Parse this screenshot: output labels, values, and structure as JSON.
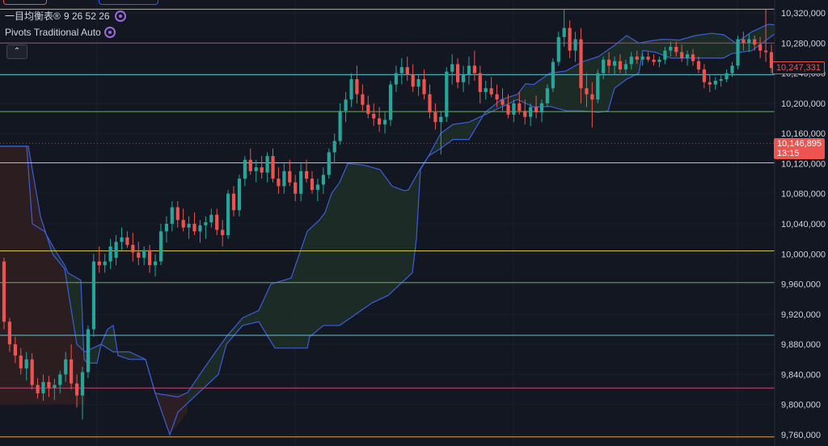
{
  "legend": {
    "ichimoku": {
      "name": "一目均衡表®",
      "params": "9 26 52 26"
    },
    "pivots": {
      "name": "Pivots Traditional Auto"
    },
    "collapse_glyph": "⌃"
  },
  "price_axis": {
    "ticks": [
      "10,320,000",
      "10,280,000",
      "10,240,000",
      "10,200,000",
      "10,160,000",
      "10,120,000",
      "10,080,000",
      "10,040,000",
      "10,000,000",
      "9,960,000",
      "9,920,000",
      "9,880,000",
      "9,840,000",
      "9,800,000",
      "9,760,000"
    ],
    "current_price_label": "10,247,331",
    "last_price_label": "10,146,895",
    "countdown": "13:15"
  },
  "colors": {
    "background": "#131722",
    "up": "#26a69a",
    "down": "#ef5350",
    "cloud_line": "#3b5ed8",
    "cloud_fill_bull": "#1f2d27",
    "cloud_fill_bear": "#2d1d22"
  },
  "chart_data": {
    "type": "candlestick",
    "y_range": [
      9756000,
      10330000
    ],
    "pivot_levels": [
      {
        "value": 10325000,
        "color": "#e0a44a"
      },
      {
        "value": 10280000,
        "color": "#b04a6a"
      },
      {
        "value": 10238000,
        "color": "#5ec6d6"
      },
      {
        "value": 10189000,
        "color": "#6fae5c"
      },
      {
        "value": 10121000,
        "color": "#d4c24a"
      },
      {
        "value": 10004000,
        "color": "#d4c24a"
      },
      {
        "value": 9962000,
        "color": "#6fae5c"
      },
      {
        "value": 9892000,
        "color": "#5ec6d6"
      },
      {
        "value": 9822000,
        "color": "#c24a78"
      },
      {
        "value": 9757000,
        "color": "#e0a44a"
      }
    ],
    "candles": [
      [
        9990000,
        9995000,
        9900000,
        9910000
      ],
      [
        9910000,
        9915000,
        9870000,
        9880000
      ],
      [
        9880000,
        9890000,
        9855000,
        9865000
      ],
      [
        9865000,
        9875000,
        9840000,
        9848000
      ],
      [
        9848000,
        9870000,
        9832000,
        9860000
      ],
      [
        9860000,
        9868000,
        9820000,
        9826000
      ],
      [
        9826000,
        9835000,
        9808000,
        9815000
      ],
      [
        9815000,
        9840000,
        9805000,
        9830000
      ],
      [
        9830000,
        9838000,
        9810000,
        9822000
      ],
      [
        9822000,
        9834000,
        9806000,
        9826000
      ],
      [
        9826000,
        9845000,
        9815000,
        9840000
      ],
      [
        9840000,
        9870000,
        9830000,
        9860000
      ],
      [
        9860000,
        9880000,
        9820000,
        9828000
      ],
      [
        9828000,
        9840000,
        9796000,
        9812000
      ],
      [
        9812000,
        9850000,
        9780000,
        9843000
      ],
      [
        9843000,
        9905000,
        9835000,
        9900000
      ],
      [
        9900000,
        10000000,
        9890000,
        9990000
      ],
      [
        9990000,
        10010000,
        9975000,
        9985000
      ],
      [
        9985000,
        10000000,
        9975000,
        9990000
      ],
      [
        9990000,
        10020000,
        9980000,
        10010000
      ],
      [
        9995000,
        10025000,
        9985000,
        10016000
      ],
      [
        10016000,
        10035000,
        10005000,
        10022000
      ],
      [
        10022000,
        10030000,
        10008000,
        10012000
      ],
      [
        10012000,
        10028000,
        9990000,
        10002000
      ],
      [
        10002000,
        10016000,
        9985000,
        9995000
      ],
      [
        9995000,
        10010000,
        9985000,
        10005000
      ],
      [
        10005000,
        10012000,
        9975000,
        9985000
      ],
      [
        9985000,
        10000000,
        9970000,
        9990000
      ],
      [
        9990000,
        10040000,
        9985000,
        10030000
      ],
      [
        10030000,
        10050000,
        10015000,
        10040000
      ],
      [
        10040000,
        10070000,
        10030000,
        10062000
      ],
      [
        10062000,
        10070000,
        10035000,
        10045000
      ],
      [
        10045000,
        10060000,
        10030000,
        10035000
      ],
      [
        10035000,
        10050000,
        10020000,
        10040000
      ],
      [
        10040000,
        10055000,
        10025000,
        10030000
      ],
      [
        10030000,
        10045000,
        10015000,
        10038000
      ],
      [
        10038000,
        10050000,
        10020000,
        10042000
      ],
      [
        10042000,
        10060000,
        10035000,
        10052000
      ],
      [
        10052000,
        10060000,
        10025000,
        10032000
      ],
      [
        10032000,
        10045000,
        10010000,
        10025000
      ],
      [
        10025000,
        10085000,
        10020000,
        10080000
      ],
      [
        10080000,
        10090000,
        10050000,
        10058000
      ],
      [
        10058000,
        10105000,
        10050000,
        10100000
      ],
      [
        10100000,
        10130000,
        10090000,
        10125000
      ],
      [
        10125000,
        10140000,
        10105000,
        10110000
      ],
      [
        10110000,
        10125000,
        10095000,
        10115000
      ],
      [
        10115000,
        10130000,
        10100000,
        10108000
      ],
      [
        10108000,
        10135000,
        10095000,
        10130000
      ],
      [
        10130000,
        10140000,
        10095000,
        10100000
      ],
      [
        10100000,
        10115000,
        10080000,
        10090000
      ],
      [
        10090000,
        10120000,
        10080000,
        10110000
      ],
      [
        10110000,
        10125000,
        10090000,
        10095000
      ],
      [
        10095000,
        10105000,
        10070000,
        10080000
      ],
      [
        10080000,
        10120000,
        10070000,
        10110000
      ],
      [
        10110000,
        10125000,
        10095000,
        10100000
      ],
      [
        10100000,
        10110000,
        10080000,
        10085000
      ],
      [
        10085000,
        10100000,
        10070000,
        10092000
      ],
      [
        10092000,
        10115000,
        10080000,
        10105000
      ],
      [
        10105000,
        10140000,
        10100000,
        10135000
      ],
      [
        10135000,
        10160000,
        10120000,
        10150000
      ],
      [
        10150000,
        10200000,
        10145000,
        10190000
      ],
      [
        10190000,
        10215000,
        10175000,
        10205000
      ],
      [
        10205000,
        10240000,
        10195000,
        10232000
      ],
      [
        10232000,
        10250000,
        10200000,
        10212000
      ],
      [
        10212000,
        10225000,
        10190000,
        10198000
      ],
      [
        10198000,
        10210000,
        10180000,
        10186000
      ],
      [
        10186000,
        10200000,
        10170000,
        10180000
      ],
      [
        10180000,
        10195000,
        10162000,
        10172000
      ],
      [
        10172000,
        10188000,
        10160000,
        10178000
      ],
      [
        10178000,
        10230000,
        10170000,
        10225000
      ],
      [
        10225000,
        10250000,
        10215000,
        10240000
      ],
      [
        10240000,
        10260000,
        10225000,
        10248000
      ],
      [
        10248000,
        10262000,
        10230000,
        10238000
      ],
      [
        10238000,
        10252000,
        10215000,
        10222000
      ],
      [
        10222000,
        10238000,
        10210000,
        10232000
      ],
      [
        10232000,
        10245000,
        10205000,
        10212000
      ],
      [
        10212000,
        10225000,
        10180000,
        10188000
      ],
      [
        10188000,
        10200000,
        10165000,
        10175000
      ],
      [
        10175000,
        10190000,
        10132000,
        10182000
      ],
      [
        10182000,
        10248000,
        10175000,
        10242000
      ],
      [
        10242000,
        10265000,
        10225000,
        10252000
      ],
      [
        10252000,
        10260000,
        10220000,
        10228000
      ],
      [
        10228000,
        10250000,
        10215000,
        10238000
      ],
      [
        10238000,
        10262000,
        10225000,
        10250000
      ],
      [
        10250000,
        10270000,
        10230000,
        10240000
      ],
      [
        10240000,
        10250000,
        10200000,
        10215000
      ],
      [
        10215000,
        10230000,
        10205000,
        10220000
      ],
      [
        10220000,
        10235000,
        10208000,
        10212000
      ],
      [
        10212000,
        10225000,
        10195000,
        10205000
      ],
      [
        10205000,
        10220000,
        10190000,
        10198000
      ],
      [
        10198000,
        10212000,
        10180000,
        10185000
      ],
      [
        10185000,
        10205000,
        10175000,
        10200000
      ],
      [
        10200000,
        10215000,
        10185000,
        10190000
      ],
      [
        10190000,
        10205000,
        10172000,
        10182000
      ],
      [
        10182000,
        10200000,
        10170000,
        10195000
      ],
      [
        10195000,
        10210000,
        10180000,
        10188000
      ],
      [
        10188000,
        10205000,
        10175000,
        10200000
      ],
      [
        10200000,
        10225000,
        10195000,
        10220000
      ],
      [
        10220000,
        10260000,
        10215000,
        10255000
      ],
      [
        10255000,
        10295000,
        10250000,
        10288000
      ],
      [
        10288000,
        10325000,
        10275000,
        10300000
      ],
      [
        10300000,
        10310000,
        10260000,
        10270000
      ],
      [
        10270000,
        10295000,
        10255000,
        10285000
      ],
      [
        10285000,
        10300000,
        10200000,
        10220000
      ],
      [
        10220000,
        10240000,
        10195000,
        10212000
      ],
      [
        10212000,
        10228000,
        10168000,
        10205000
      ],
      [
        10205000,
        10245000,
        10200000,
        10240000
      ],
      [
        10240000,
        10262000,
        10232000,
        10258000
      ],
      [
        10258000,
        10268000,
        10240000,
        10250000
      ],
      [
        10250000,
        10262000,
        10238000,
        10256000
      ],
      [
        10256000,
        10265000,
        10240000,
        10245000
      ],
      [
        10245000,
        10258000,
        10238000,
        10252000
      ],
      [
        10252000,
        10268000,
        10245000,
        10262000
      ],
      [
        10262000,
        10270000,
        10252000,
        10258000
      ],
      [
        10258000,
        10266000,
        10250000,
        10262000
      ],
      [
        10262000,
        10268000,
        10255000,
        10258000
      ],
      [
        10258000,
        10265000,
        10250000,
        10255000
      ],
      [
        10255000,
        10262000,
        10248000,
        10258000
      ],
      [
        10258000,
        10275000,
        10252000,
        10270000
      ],
      [
        10270000,
        10282000,
        10262000,
        10275000
      ],
      [
        10275000,
        10282000,
        10262000,
        10268000
      ],
      [
        10268000,
        10278000,
        10255000,
        10260000
      ],
      [
        10260000,
        10270000,
        10250000,
        10265000
      ],
      [
        10265000,
        10272000,
        10250000,
        10256000
      ],
      [
        10256000,
        10262000,
        10240000,
        10245000
      ],
      [
        10245000,
        10252000,
        10220000,
        10228000
      ],
      [
        10228000,
        10238000,
        10215000,
        10225000
      ],
      [
        10225000,
        10235000,
        10218000,
        10230000
      ],
      [
        10230000,
        10238000,
        10222000,
        10232000
      ],
      [
        10232000,
        10245000,
        10228000,
        10240000
      ],
      [
        10240000,
        10255000,
        10235000,
        10250000
      ],
      [
        10250000,
        10290000,
        10245000,
        10285000
      ],
      [
        10285000,
        10295000,
        10270000,
        10280000
      ],
      [
        10280000,
        10292000,
        10268000,
        10285000
      ],
      [
        10285000,
        10290000,
        10270000,
        10278000
      ],
      [
        10278000,
        10288000,
        10260000,
        10270000
      ],
      [
        10270000,
        10325000,
        10255000,
        10268000
      ],
      [
        10268000,
        10278000,
        10240000,
        10247000
      ]
    ],
    "cloud_top": [
      [
        0,
        10143000
      ],
      [
        33,
        10143000
      ],
      [
        40,
        10040000
      ],
      [
        55,
        10030000
      ],
      [
        68,
        10005000
      ],
      [
        80,
        9985000
      ],
      [
        84,
        9975000
      ],
      [
        100,
        9965000
      ],
      [
        104,
        9860000
      ],
      [
        108,
        9855000
      ],
      [
        120,
        9855000
      ],
      [
        125,
        9880000
      ],
      [
        133,
        9900000
      ],
      [
        140,
        9905000
      ],
      [
        146,
        9865000
      ],
      [
        160,
        9860000
      ],
      [
        180,
        9860000
      ],
      [
        192,
        9815000
      ],
      [
        220,
        9810000
      ],
      [
        232,
        9816000
      ],
      [
        260,
        9860000
      ],
      [
        280,
        9890000
      ],
      [
        300,
        9915000
      ],
      [
        320,
        9925000
      ],
      [
        335,
        9960000
      ],
      [
        360,
        9968000
      ],
      [
        380,
        10030000
      ],
      [
        395,
        10045000
      ],
      [
        402,
        10055000
      ],
      [
        410,
        10080000
      ],
      [
        420,
        10095000
      ],
      [
        430,
        10120000
      ],
      [
        450,
        10118000
      ],
      [
        470,
        10112000
      ],
      [
        485,
        10090000
      ],
      [
        500,
        10084000
      ],
      [
        505,
        10085000
      ],
      [
        518,
        10110000
      ],
      [
        530,
        10130000
      ],
      [
        545,
        10140000
      ],
      [
        560,
        10152000
      ],
      [
        580,
        10152000
      ],
      [
        600,
        10188000
      ],
      [
        620,
        10205000
      ],
      [
        640,
        10212000
      ],
      [
        650,
        10226000
      ],
      [
        660,
        10225000
      ],
      [
        680,
        10240000
      ],
      [
        700,
        10243000
      ],
      [
        720,
        10255000
      ],
      [
        740,
        10262000
      ],
      [
        760,
        10277000
      ],
      [
        775,
        10290000
      ],
      [
        790,
        10280000
      ],
      [
        805,
        10283000
      ],
      [
        820,
        10285000
      ],
      [
        840,
        10284000
      ],
      [
        860,
        10290000
      ],
      [
        880,
        10293000
      ],
      [
        895,
        10291000
      ],
      [
        910,
        10280000
      ],
      [
        930,
        10295000
      ],
      [
        950,
        10305000
      ],
      [
        960,
        10304000
      ]
    ],
    "cloud_bottom": [
      [
        0,
        10143000
      ],
      [
        35,
        10143000
      ],
      [
        50,
        10050000
      ],
      [
        65,
        10000000
      ],
      [
        80,
        9980000
      ],
      [
        95,
        9880000
      ],
      [
        105,
        9870000
      ],
      [
        125,
        9880000
      ],
      [
        140,
        9870000
      ],
      [
        160,
        9870000
      ],
      [
        180,
        9860000
      ],
      [
        192,
        9815000
      ],
      [
        210,
        9760000
      ],
      [
        220,
        9790000
      ],
      [
        240,
        9810000
      ],
      [
        260,
        9830000
      ],
      [
        270,
        9840000
      ],
      [
        280,
        9880000
      ],
      [
        300,
        9905000
      ],
      [
        320,
        9910000
      ],
      [
        340,
        9875000
      ],
      [
        360,
        9875000
      ],
      [
        380,
        9875000
      ],
      [
        383,
        9890000
      ],
      [
        400,
        9905000
      ],
      [
        420,
        9905000
      ],
      [
        440,
        9920000
      ],
      [
        460,
        9935000
      ],
      [
        480,
        9945000
      ],
      [
        500,
        9965000
      ],
      [
        510,
        9975000
      ],
      [
        515,
        10020000
      ],
      [
        520,
        10112000
      ],
      [
        530,
        10130000
      ],
      [
        545,
        10160000
      ],
      [
        560,
        10172000
      ],
      [
        580,
        10175000
      ],
      [
        600,
        10185000
      ],
      [
        620,
        10195000
      ],
      [
        640,
        10205000
      ],
      [
        660,
        10195000
      ],
      [
        680,
        10196000
      ],
      [
        700,
        10190000
      ],
      [
        720,
        10190000
      ],
      [
        740,
        10188000
      ],
      [
        752,
        10190000
      ],
      [
        760,
        10220000
      ],
      [
        775,
        10232000
      ],
      [
        790,
        10240000
      ],
      [
        795,
        10270000
      ],
      [
        810,
        10268000
      ],
      [
        830,
        10260000
      ],
      [
        860,
        10260000
      ],
      [
        895,
        10260000
      ],
      [
        905,
        10266000
      ],
      [
        930,
        10270000
      ],
      [
        958,
        10292000
      ]
    ]
  }
}
